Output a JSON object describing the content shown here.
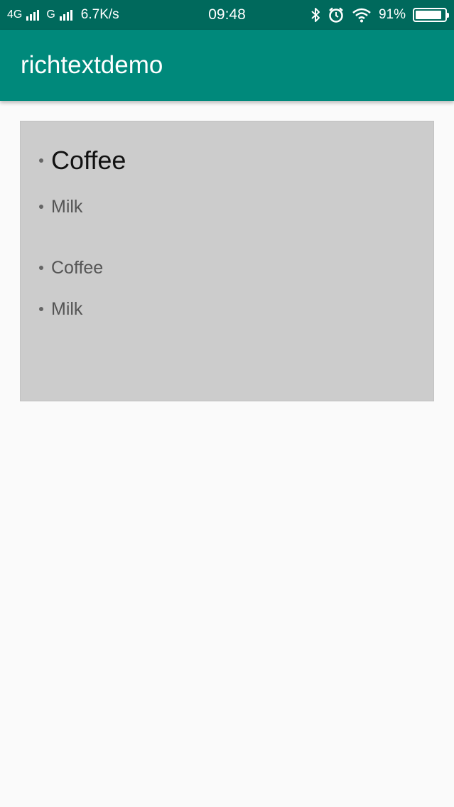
{
  "status_bar": {
    "network_1": "4G",
    "network_2": "G",
    "speed": "6.7K/s",
    "time": "09:48",
    "battery_text": "91%",
    "battery_level": 0.91,
    "icons": [
      "signal-icon",
      "bluetooth-icon",
      "alarm-icon",
      "wifi-icon",
      "battery-icon"
    ]
  },
  "app_bar": {
    "title": "richtextdemo",
    "color": "#00897b",
    "status_color": "#00695c"
  },
  "content": {
    "background": "#cccccc",
    "list_1": [
      {
        "label": "Coffee",
        "style": "large"
      },
      {
        "label": "Milk",
        "style": "normal"
      }
    ],
    "list_2": [
      {
        "label": "Coffee"
      },
      {
        "label": "Milk"
      }
    ]
  }
}
